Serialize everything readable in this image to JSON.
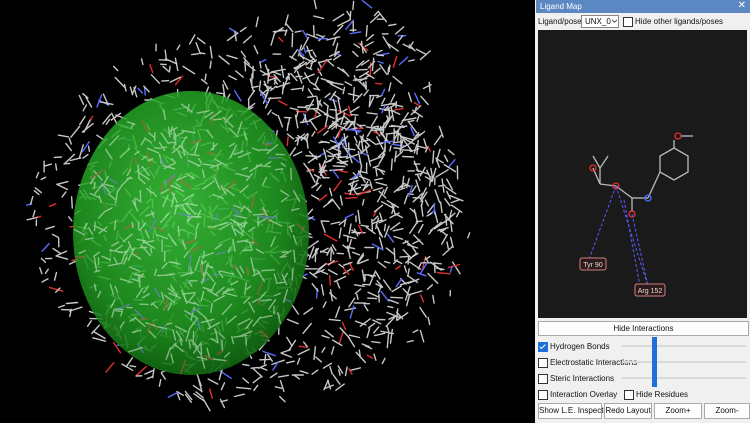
{
  "panel": {
    "title": "Ligand Map",
    "close_glyph": "✕",
    "pose_label": "Ligand/pose:",
    "pose_value": "UNX_0",
    "hide_others_label": "Hide other ligands/poses",
    "hide_others_checked": false
  },
  "ligand_map": {
    "residues": [
      "Tyr 90",
      "Arg 152"
    ],
    "atom_letters": [
      "N"
    ]
  },
  "controls": {
    "hide_interactions": "Hide Interactions",
    "hydrogen_bonds": "Hydrogen Bonds",
    "electrostatic": "Electrostatic Interactions",
    "steric": "Steric Interactions",
    "overlay": "Interaction Overlay",
    "hide_residues": "Hide Residues",
    "hydrogen_checked": true,
    "electrostatic_checked": false,
    "steric_checked": false,
    "overlay_checked": false,
    "hide_residues_checked": false
  },
  "buttons": {
    "show_le": "Show L.E. Inspector",
    "redo": "Redo Layout",
    "zoom_in": "Zoom+",
    "zoom_out": "Zoom-"
  },
  "colors": {
    "viewer_bg": "#000000",
    "sphere": "#2ea82e",
    "title_bar": "#5b87c2",
    "accent": "#1e6fd9"
  }
}
